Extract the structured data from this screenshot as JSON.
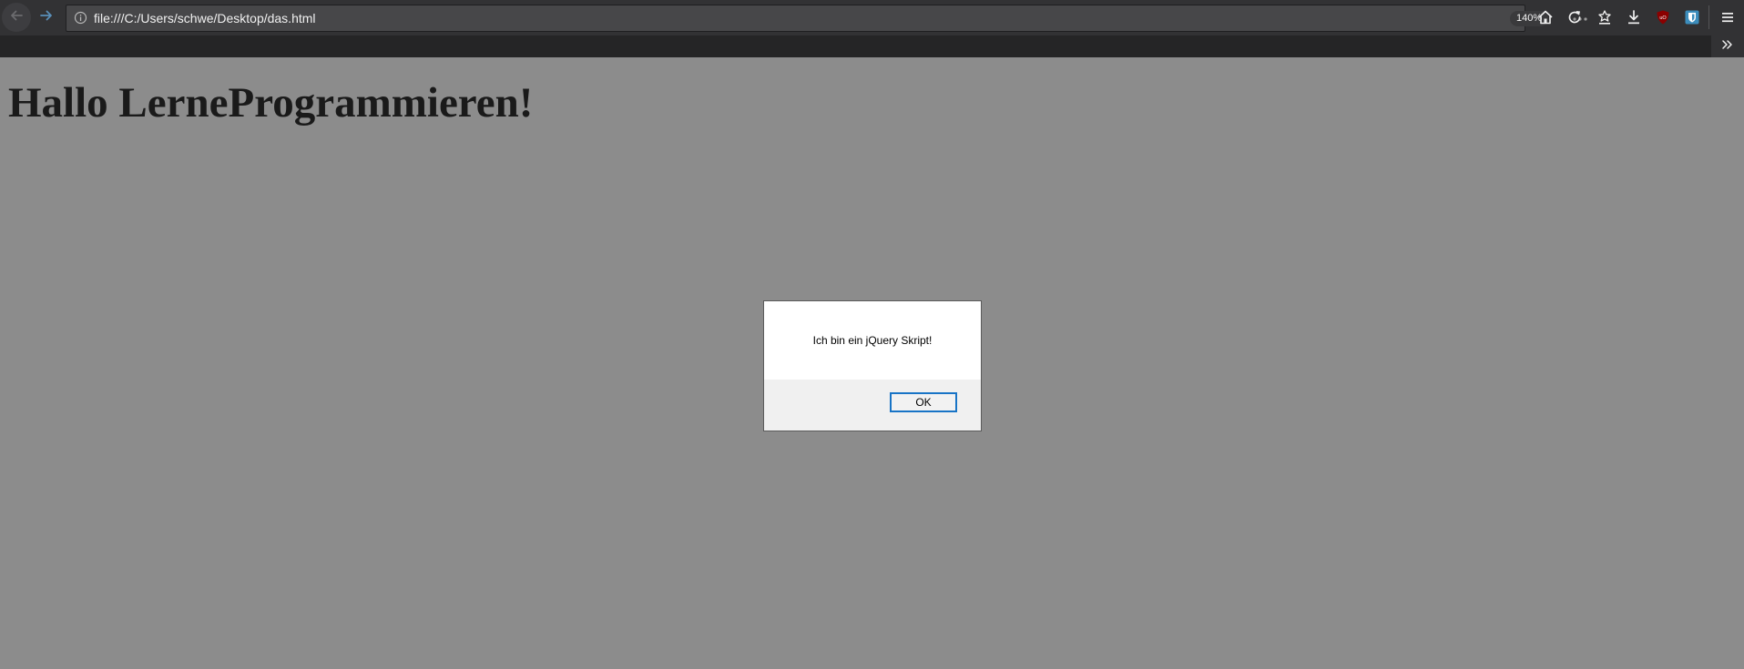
{
  "browser": {
    "url": "file:///C:/Users/schwe/Desktop/das.html",
    "zoom": "140%",
    "toolbar_icons": [
      "back-icon",
      "forward-icon",
      "info-icon",
      "more-icon",
      "home-icon",
      "reload-icon",
      "library-icon",
      "download-icon",
      "ublock-icon",
      "bitwarden-icon",
      "menu-icon",
      "overflow-chevron-icon"
    ],
    "colors": {
      "toolbar": "#323234",
      "urlbar": "#474749",
      "bookmarks_bar": "#252526",
      "accent_blue": "#1874c6",
      "ublock_red": "#8b0000"
    }
  },
  "page": {
    "heading": "Hallo LerneProgrammieren!",
    "background": "#8c8c8c"
  },
  "dialog": {
    "message": "Ich bin ein jQuery Skript!",
    "ok_label": "OK"
  }
}
